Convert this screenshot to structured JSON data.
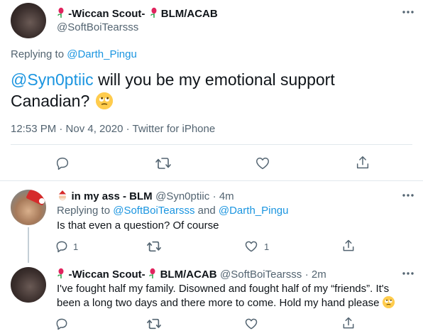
{
  "main_tweet": {
    "author": {
      "display_name": "-Wiccan Scout-",
      "display_name_suffix": "BLM/ACAB",
      "handle": "@SoftBoiTearsss"
    },
    "replying_to_label": "Replying to",
    "replying_to_user": "@Darth_Pingu",
    "mention": "@Syn0ptiic",
    "text_line1": " will you be my emotional support",
    "text_line2": "Canadian?",
    "emoji": "rolling-eyes",
    "timestamp": "12:53 PM · Nov 4, 2020 · Twitter for iPhone"
  },
  "reply_1": {
    "author": {
      "display_name": "in my ass - BLM",
      "handle": "@Syn0ptiic",
      "time": "· 4m"
    },
    "replying_to_label": "Replying to",
    "replying_to_user1": "@SoftBoiTearsss",
    "replying_to_and": " and ",
    "replying_to_user2": "@Darth_Pingu",
    "text": "Is that even a question? Of course",
    "reply_count": "1",
    "like_count": "1"
  },
  "reply_2": {
    "author": {
      "display_name": "-Wiccan Scout-",
      "display_name_suffix": "BLM/ACAB",
      "handle": "@SoftBoiTearsss",
      "time": "· 2m"
    },
    "text_line1": "I've fought half my family. Disowned and fought half of my “friends”. It's",
    "text_line2": "been a long two days and there more to come. Hold my hand please",
    "emoji": "rolling-eyes"
  },
  "colors": {
    "link": "#1b95e0",
    "muted": "#536471",
    "divider": "#e1e8ed"
  }
}
